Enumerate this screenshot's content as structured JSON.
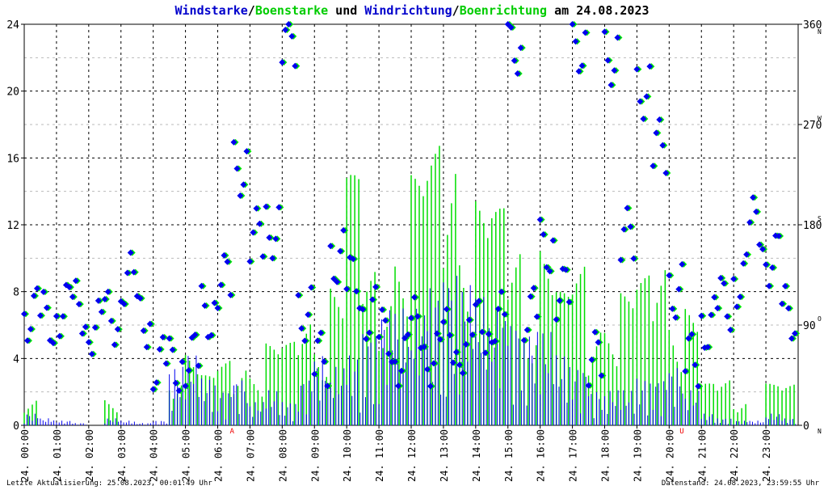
{
  "chart_data": {
    "type": "line",
    "title_parts": [
      {
        "text": "Windstarke",
        "color": "#0000cc"
      },
      {
        "text": "/",
        "color": "#000000"
      },
      {
        "text": "Boenstarke",
        "color": "#00cc00"
      },
      {
        "text": " und ",
        "color": "#000000"
      },
      {
        "text": "Windrichtung",
        "color": "#0000cc"
      },
      {
        "text": "/",
        "color": "#000000"
      },
      {
        "text": "Boenrichtung",
        "color": "#00cc00"
      },
      {
        "text": " am 24.08.2023",
        "color": "#000000"
      }
    ],
    "ylim": [
      0,
      24
    ],
    "yticks": [
      "0",
      "4",
      "8",
      "12",
      "16",
      "20",
      "24"
    ],
    "y2lim": [
      0,
      360
    ],
    "y2ticks": [
      {
        "v": "0",
        "d": "N"
      },
      {
        "v": "90",
        "d": "O"
      },
      {
        "v": "180",
        "d": "S"
      },
      {
        "v": "270",
        "d": "W"
      },
      {
        "v": "360",
        "d": "N"
      }
    ],
    "xticks": [
      "24. 00:00",
      "24. 01:00",
      "24. 02:00",
      "24. 03:00",
      "24. 04:00",
      "24. 05:00",
      "24. 06:00",
      "24. 07:00",
      "24. 08:00",
      "24. 09:00",
      "24. 10:00",
      "24. 11:00",
      "24. 12:00",
      "24. 13:00",
      "24. 14:00",
      "24. 15:00",
      "24. 16:00",
      "24. 17:00",
      "24. 18:00",
      "24. 19:00",
      "24. 20:00",
      "24. 21:00",
      "24. 22:00",
      "24. 23:00"
    ],
    "markers": [
      {
        "label": "A",
        "hour": 6.45
      },
      {
        "label": "U",
        "hour": 20.4
      }
    ],
    "x_hours_step": 0.5,
    "series": [
      {
        "name": "Windstarke",
        "color": "#0000ee",
        "values": [
          0.5,
          0.3,
          0.2,
          0.1,
          0,
          0.3,
          0.2,
          0.1,
          0.2,
          2.5,
          3,
          2,
          1.5,
          2,
          1,
          1.5,
          1,
          2,
          3,
          2.5,
          3,
          4,
          5,
          5,
          5,
          6,
          6.5,
          6,
          5.5,
          5,
          4.5,
          4,
          4,
          3,
          2.5,
          1.5,
          1.5,
          1.5,
          2,
          2,
          2.5,
          1.5,
          0.5,
          0.3,
          0.2,
          0.2,
          0.5,
          0.3
        ]
      },
      {
        "name": "Boenstarke",
        "color": "#00dd00",
        "values": [
          2.5,
          0,
          0,
          0,
          0,
          2.5,
          0,
          0,
          0,
          5,
          5,
          3,
          4,
          5,
          4,
          5,
          5,
          7.5,
          8,
          9,
          15,
          10,
          13,
          12,
          15,
          17,
          21,
          15,
          14,
          13,
          12,
          11,
          12,
          8,
          10,
          9,
          7.5,
          8,
          9,
          12,
          10,
          7.5,
          2.5,
          3,
          2.5,
          0,
          2.5,
          2.5
        ]
      },
      {
        "name": "Windrichtung",
        "color": "#0000ee",
        "values": [
          100,
          95,
          105,
          105,
          88,
          97,
          130,
          95,
          55,
          54,
          60,
          100,
          130,
          230,
          170,
          175,
          345,
          100,
          60,
          150,
          130,
          100,
          80,
          60,
          90,
          60,
          80,
          70,
          90,
          95,
          340,
          100,
          160,
          120,
          340,
          60,
          330,
          170,
          300,
          250,
          120,
          60,
          90,
          110,
          130,
          180,
          150,
          100
        ]
      }
    ]
  },
  "footer": {
    "left": "Letzte Aktualisierung: 25.08.2023, 00:01:49 Uhr",
    "right": "Datenstand: 24.08.2023, 23:59:55 Uhr"
  }
}
